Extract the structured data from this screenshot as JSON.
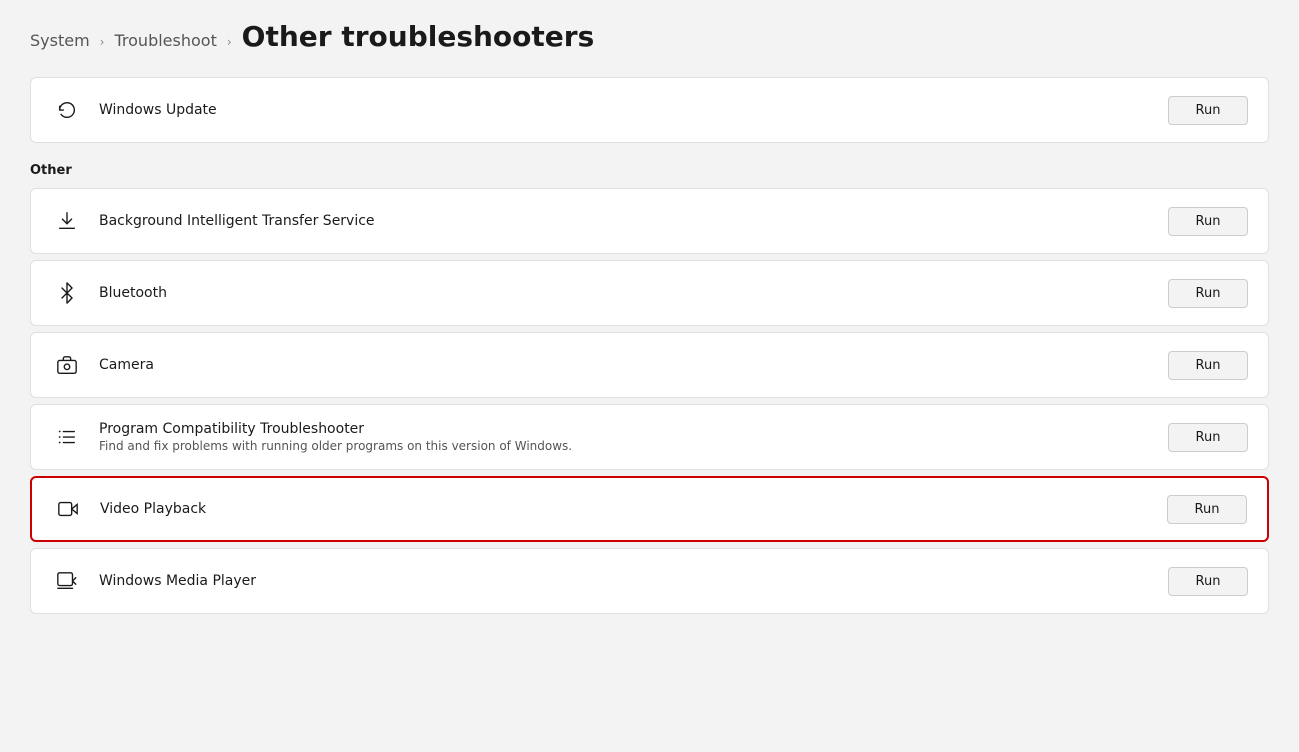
{
  "breadcrumb": {
    "system": "System",
    "troubleshoot": "Troubleshoot",
    "current": "Other troubleshooters",
    "sep": "›"
  },
  "top_section": {
    "items": [
      {
        "id": "windows-update",
        "icon": "refresh-icon",
        "title": "Windows Update",
        "description": "",
        "run_label": "Run",
        "highlighted": false
      }
    ]
  },
  "other_section": {
    "label": "Other",
    "items": [
      {
        "id": "bits",
        "icon": "download-icon",
        "title": "Background Intelligent Transfer Service",
        "description": "",
        "run_label": "Run",
        "highlighted": false
      },
      {
        "id": "bluetooth",
        "icon": "bluetooth-icon",
        "title": "Bluetooth",
        "description": "",
        "run_label": "Run",
        "highlighted": false
      },
      {
        "id": "camera",
        "icon": "camera-icon",
        "title": "Camera",
        "description": "",
        "run_label": "Run",
        "highlighted": false
      },
      {
        "id": "program-compat",
        "icon": "list-icon",
        "title": "Program Compatibility Troubleshooter",
        "description": "Find and fix problems with running older programs on this version of Windows.",
        "run_label": "Run",
        "highlighted": false
      },
      {
        "id": "video-playback",
        "icon": "video-icon",
        "title": "Video Playback",
        "description": "",
        "run_label": "Run",
        "highlighted": true
      },
      {
        "id": "windows-media-player",
        "icon": "media-player-icon",
        "title": "Windows Media Player",
        "description": "",
        "run_label": "Run",
        "highlighted": false
      }
    ]
  }
}
